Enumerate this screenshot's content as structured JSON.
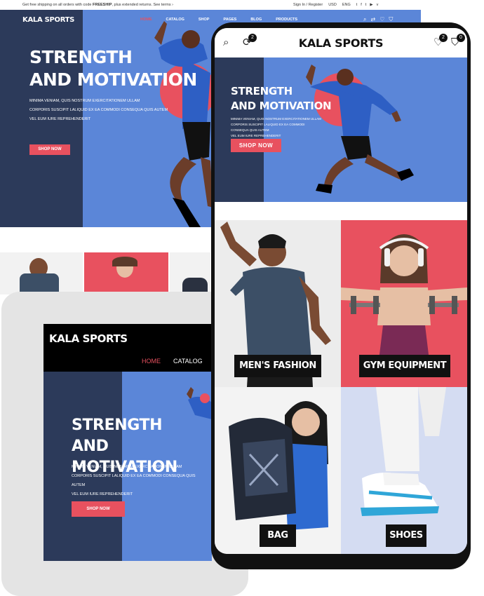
{
  "brand": "KALA SPORTS",
  "colors": {
    "accent": "#e8515f",
    "hero_blue": "#5b86d8",
    "hero_navy": "#2c3a5a",
    "gym_pink": "#e8515f"
  },
  "desktop": {
    "promo_prefix": "Get free shipping on all orders with code ",
    "promo_code": "FREESHIP",
    "promo_suffix": ", plus extended returns. See terms ›",
    "signin": "Sign In / Register",
    "currency": "USD",
    "language": "ENG",
    "social": [
      "t-icon",
      "f-icon",
      "t-icon",
      "youtube-icon",
      "v-icon"
    ],
    "nav": [
      "HOME",
      "CATALOG",
      "SHOP",
      "PAGES",
      "BLOG",
      "PRODUCTS"
    ],
    "headline_1": "STRENGTH",
    "headline_2": "AND MOTIVATION",
    "sub_1": "MINIMA VENIAM, QUIS NOSTRUM EXERCITATIONEM ULLAM",
    "sub_2": "CORPORIS SUSCIPIT LALIQUID EX EA COMMODI CONSEQUA QUIS AUTEM",
    "sub_3": "VEL EUM IURE REPREHENDERIT",
    "cta": "SHOP NOW"
  },
  "tablet": {
    "nav": [
      "HOME",
      "CATALOG"
    ],
    "headline_1": "STRENGTH",
    "headline_2": "AND MOTIVATION",
    "sub_1": "MINIMA VENIAM, QUIS NOSTRUM EXERCITATIONEM ULLAM",
    "sub_2": "CORPORIS SUSCIPIT LALIQUID EX EA COMMODI CONSEQUA QUIS AUTEM",
    "sub_3": "VEL EUM IURE REPREHENDERIT",
    "cta": "SHOP NOW"
  },
  "phone": {
    "compare_count": "2",
    "wishlist_count": "2",
    "cart_count": "0",
    "headline_1": "STRENGTH",
    "headline_2": "AND MOTIVATION",
    "sub_1": "MINIMA VENIAM, QUIS NOSTRUM EXERCITATIONEM ULLAM",
    "sub_2": "CORPORIS SUSCIPIT LALIQUID EX EA COMMODI CONSEQUA QUIS AUTEM",
    "sub_3": "VEL EUM IURE REPREHENDERIT",
    "cta": "SHOP NOW",
    "categories": [
      "MEN'S FASHION",
      "GYM EQUIPMENT",
      "BAG",
      "SHOES"
    ]
  }
}
